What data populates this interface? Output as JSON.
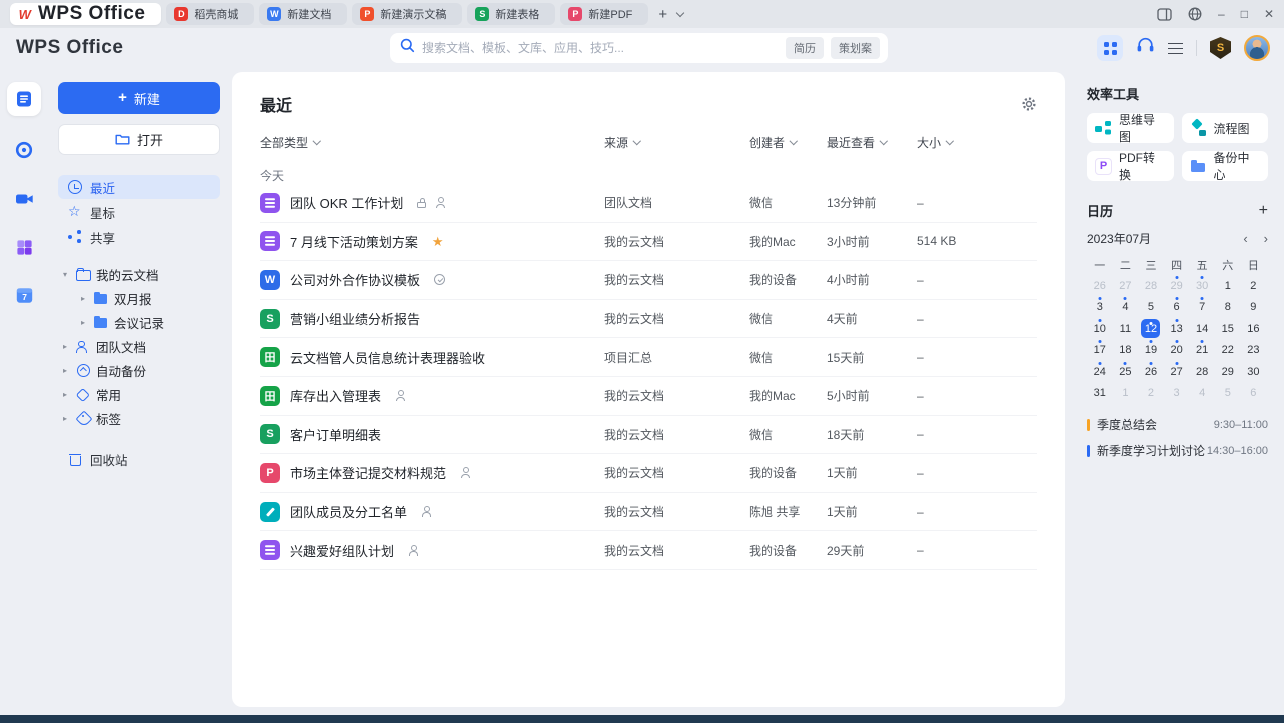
{
  "icons": {
    "minimize": "–",
    "maximize": "□",
    "close": "✕"
  },
  "tabbar": {
    "new_tab_label": "+",
    "tabs": [
      {
        "label": "WPS Office",
        "icon": "wps-logo-icon",
        "glyph": "W",
        "color": "",
        "active": true,
        "logo": true
      },
      {
        "label": "稻壳商城",
        "icon": "docer-store-icon",
        "glyph": "D",
        "color": "#e8382f"
      },
      {
        "label": "新建文档",
        "icon": "writer-doc-icon",
        "glyph": "W",
        "color": "#3a7af0"
      },
      {
        "label": "新建演示文稿",
        "icon": "presentation-icon",
        "glyph": "P",
        "color": "#f0502c"
      },
      {
        "label": "新建表格",
        "icon": "spreadsheet-icon",
        "glyph": "S",
        "color": "#17a35b"
      },
      {
        "label": "新建PDF",
        "icon": "pdf-icon",
        "glyph": "P",
        "color": "#e6486b"
      }
    ]
  },
  "header": {
    "logo": "WPS Office",
    "search": {
      "placeholder": "搜索文档、模板、文库、应用、技巧...",
      "tags": [
        "简历",
        "策划案"
      ]
    }
  },
  "rail": {
    "icons": [
      "wps-docs-icon",
      "timeline-icon",
      "meeting-icon",
      "apps-icon",
      "calendar-7-icon"
    ],
    "calendar_glyph": "7"
  },
  "sidebar": {
    "new_label": "新建",
    "open_label": "打开",
    "nav": [
      {
        "label": "最近",
        "icon": "clock-icon",
        "active": true
      },
      {
        "label": "星标",
        "icon": "star-outline-icon"
      },
      {
        "label": "共享",
        "icon": "share-icon"
      }
    ],
    "tree": [
      {
        "label": "我的云文档",
        "icon": "cloud-folder-icon",
        "caret": "▾",
        "level": 0
      },
      {
        "label": "双月报",
        "icon": "folder-icon",
        "caret": "▸",
        "level": 1
      },
      {
        "label": "会议记录",
        "icon": "folder-icon",
        "caret": "▸",
        "level": 1
      },
      {
        "label": "团队文档",
        "icon": "team-icon",
        "caret": "▸",
        "level": 0
      },
      {
        "label": "自动备份",
        "icon": "auto-backup-icon",
        "caret": "▸",
        "level": 0
      },
      {
        "label": "常用",
        "icon": "frequent-icon",
        "caret": "▸",
        "level": 0
      },
      {
        "label": "标签",
        "icon": "tag-icon",
        "caret": "▸",
        "level": 0
      }
    ],
    "trash_label": "回收站"
  },
  "main": {
    "title": "最近",
    "section": "今天",
    "filters": {
      "type": "全部类型",
      "source": "来源",
      "creator": "创建者",
      "viewed": "最近查看",
      "size": "大小"
    },
    "rows": [
      {
        "title": "团队 OKR 工作计划",
        "icon": {
          "name": "wps-smart-doc-icon",
          "bg": "#8f54ee",
          "glyph": "lines"
        },
        "badges": [
          "lock-icon",
          "people-icon"
        ],
        "source": "团队文档",
        "creator": "微信",
        "viewed": "13分钟前",
        "size": "–"
      },
      {
        "title": "7 月线下活动策划方案",
        "icon": {
          "name": "wps-smart-doc-icon",
          "bg": "#8f54ee",
          "glyph": "lines"
        },
        "badges": [
          "star-icon"
        ],
        "source": "我的云文档",
        "creator": "我的Mac",
        "viewed": "3小时前",
        "size": "514 KB"
      },
      {
        "title": "公司对外合作协议模板",
        "icon": {
          "name": "word-doc-icon",
          "bg": "#2d6ce8",
          "glyph": "W"
        },
        "badges": [
          "check-icon"
        ],
        "source": "我的云文档",
        "creator": "我的设备",
        "viewed": "4小时前",
        "size": "–"
      },
      {
        "title": "营销小组业绩分析报告",
        "icon": {
          "name": "sheet-doc-icon",
          "bg": "#18a05f",
          "glyph": "S"
        },
        "badges": [],
        "source": "我的云文档",
        "creator": "微信",
        "viewed": "4天前",
        "size": "–"
      },
      {
        "title": "云文档管人员信息统计表理器验收",
        "icon": {
          "name": "smart-sheet-icon",
          "bg": "#15a348",
          "glyph": "田"
        },
        "badges": [],
        "source": "项目汇总",
        "creator": "微信",
        "viewed": "15天前",
        "size": "–"
      },
      {
        "title": "库存出入管理表",
        "icon": {
          "name": "smart-sheet-icon",
          "bg": "#15a348",
          "glyph": "田"
        },
        "badges": [
          "people-icon"
        ],
        "source": "我的云文档",
        "creator": "我的Mac",
        "viewed": "5小时前",
        "size": "–"
      },
      {
        "title": "客户订单明细表",
        "icon": {
          "name": "sheet-doc-icon",
          "bg": "#18a05f",
          "glyph": "S"
        },
        "badges": [],
        "source": "我的云文档",
        "creator": "微信",
        "viewed": "18天前",
        "size": "–"
      },
      {
        "title": "市场主体登记提交材料规范",
        "icon": {
          "name": "pdf-doc-icon",
          "bg": "#e6486b",
          "glyph": "P"
        },
        "badges": [
          "people-icon"
        ],
        "source": "我的云文档",
        "creator": "我的设备",
        "viewed": "1天前",
        "size": "–"
      },
      {
        "title": "团队成员及分工名单",
        "icon": {
          "name": "form-doc-icon",
          "bg": "#00aebb",
          "glyph": "pencil"
        },
        "badges": [
          "people-icon"
        ],
        "source": "我的云文档",
        "creator": "陈旭 共享",
        "viewed": "1天前",
        "size": "–"
      },
      {
        "title": "兴趣爱好组队计划",
        "icon": {
          "name": "wps-smart-doc-icon",
          "bg": "#8f54ee",
          "glyph": "lines"
        },
        "badges": [
          "people-icon"
        ],
        "source": "我的云文档",
        "creator": "我的设备",
        "viewed": "29天前",
        "size": "–"
      }
    ]
  },
  "right": {
    "tools_title": "效率工具",
    "tools": [
      {
        "label": "思维导图",
        "icon": "mind-map-icon"
      },
      {
        "label": "流程图",
        "icon": "flowchart-icon"
      },
      {
        "label": "PDF转换",
        "icon": "pdf-convert-icon",
        "glyph": "P"
      },
      {
        "label": "备份中心",
        "icon": "backup-folder-icon"
      }
    ],
    "calendar": {
      "title": "日历",
      "add": "+",
      "month": "2023年07月",
      "prev": "‹",
      "next": "›",
      "weekdays": [
        "一",
        "二",
        "三",
        "四",
        "五",
        "六",
        "日"
      ],
      "days": [
        {
          "d": "26",
          "muted": true
        },
        {
          "d": "27",
          "muted": true
        },
        {
          "d": "28",
          "muted": true
        },
        {
          "d": "29",
          "muted": true,
          "dot": true
        },
        {
          "d": "30",
          "muted": true,
          "dot": true
        },
        {
          "d": "1"
        },
        {
          "d": "2"
        },
        {
          "d": "3",
          "dot": true
        },
        {
          "d": "4",
          "dot": true
        },
        {
          "d": "5"
        },
        {
          "d": "6",
          "dot": true
        },
        {
          "d": "7",
          "dot": true
        },
        {
          "d": "8"
        },
        {
          "d": "9"
        },
        {
          "d": "10",
          "dot": true
        },
        {
          "d": "11"
        },
        {
          "d": "12",
          "selected": true,
          "dot": true
        },
        {
          "d": "13",
          "dot": true
        },
        {
          "d": "14"
        },
        {
          "d": "15"
        },
        {
          "d": "16"
        },
        {
          "d": "17",
          "dot": true
        },
        {
          "d": "18"
        },
        {
          "d": "19",
          "dot": true
        },
        {
          "d": "20",
          "dot": true
        },
        {
          "d": "21",
          "dot": true
        },
        {
          "d": "22"
        },
        {
          "d": "23"
        },
        {
          "d": "24",
          "dot": true
        },
        {
          "d": "25",
          "dot": true
        },
        {
          "d": "26",
          "dot": true
        },
        {
          "d": "27",
          "dot": true
        },
        {
          "d": "28"
        },
        {
          "d": "29"
        },
        {
          "d": "30"
        },
        {
          "d": "31"
        },
        {
          "d": "1",
          "muted": true
        },
        {
          "d": "2",
          "muted": true
        },
        {
          "d": "3",
          "muted": true
        },
        {
          "d": "4",
          "muted": true
        },
        {
          "d": "5",
          "muted": true
        },
        {
          "d": "6",
          "muted": true
        }
      ]
    },
    "events": [
      {
        "title": "季度总结会",
        "time": "9:30–11:00",
        "color": "#f7a325"
      },
      {
        "title": "新季度学习计划讨论",
        "time": "14:30–16:00",
        "color": "#2a6af3"
      }
    ]
  }
}
